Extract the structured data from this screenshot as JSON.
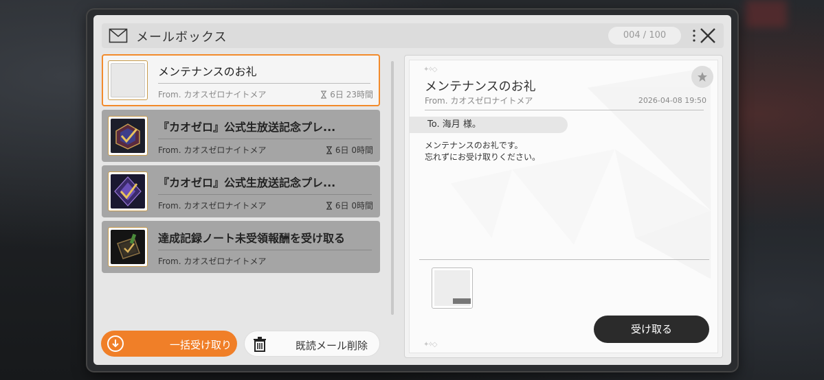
{
  "header": {
    "title": "メールボックス",
    "counter": "004 / 100"
  },
  "mail_list": [
    {
      "subject": "メンテナンスのお礼",
      "from": "From. カオスゼロナイトメア",
      "time_left": "6日 23時間",
      "selected": true,
      "thumb": "blank-item"
    },
    {
      "subject": "『カオゼロ』公式生放送記念プレ...",
      "from": "From. カオスゼロナイトメア",
      "time_left": "6日 0時間",
      "selected": false,
      "thumb": "crystal-box-red"
    },
    {
      "subject": "『カオゼロ』公式生放送記念プレ...",
      "from": "From. カオスゼロナイトメア",
      "time_left": "6日 0時間",
      "selected": false,
      "thumb": "crystal-box-purple"
    },
    {
      "subject": "達成記録ノート未受領報酬を受け取る",
      "from": "From. カオスゼロナイトメア",
      "time_left": "",
      "selected": false,
      "thumb": "notebook"
    }
  ],
  "buttons": {
    "bulk_receive": "一括受け取り",
    "delete_read": "既読メール削除",
    "receive": "受け取る"
  },
  "detail": {
    "subject": "メンテナンスのお礼",
    "from": "From. カオスゼロナイトメア",
    "date": "2026-04-08 19:50",
    "to": "To. 海月 様。",
    "body_lines": [
      "メンテナンスのお礼です。",
      "忘れずにお受け取りください。"
    ]
  },
  "colors": {
    "accent": "#f07f28",
    "selected_border": "#f28a2a",
    "item_bg": "#a5a5a5",
    "dark_button": "#2b2b2b"
  }
}
